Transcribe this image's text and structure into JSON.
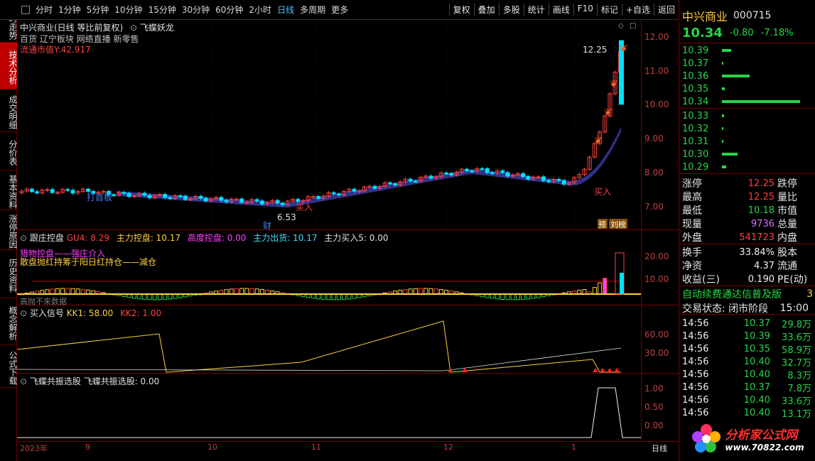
{
  "toolbar": {
    "periods": [
      "分时",
      "1分钟",
      "5分钟",
      "10分钟",
      "15分钟",
      "30分钟",
      "60分钟",
      "2小时",
      "日线",
      "多周期",
      "更多"
    ],
    "active_period": "日线",
    "tools": [
      "复权",
      "叠加",
      "多股",
      "统计",
      "画线",
      "F10",
      "标记",
      "+自选",
      "返回"
    ]
  },
  "left_tabs": [
    "分时走势",
    "技术分析",
    "成交明细",
    "分价表",
    "基本资料",
    "涨停原因",
    "历史资料",
    "概念解析",
    "公式下载"
  ],
  "active_tab": "技术分析",
  "main_pane": {
    "title": "中兴商业(日线 等比前复权)",
    "formula": "飞蝶妖龙",
    "tags": "百货 辽宁板块 网络直播 新零售",
    "market_cap_label": "流通市值Y:42.917",
    "y_ticks": [
      "12.00",
      "11.00",
      "10.00",
      "9.00",
      "8.00",
      "7.00"
    ],
    "y_values": [
      12,
      11,
      10,
      9,
      8,
      7
    ],
    "y_range": [
      6.3,
      12.5
    ],
    "annotations": {
      "high_value": "12.25",
      "low_value": "6.53",
      "daban": "打首板",
      "buy": "买入",
      "cai": "财",
      "yu": "预",
      "liubang": "刘榜"
    }
  },
  "pane2": {
    "name": "跟庄控盘",
    "fields": [
      {
        "text": "GU4: 8.29",
        "color": "#ff4040"
      },
      {
        "text": "主力控盘: 10.17",
        "color": "#ffd040"
      },
      {
        "text": "高度控盘: 0.00",
        "color": "#ff40ff"
      },
      {
        "text": "主力出货: 10.17",
        "color": "#40e0ff"
      },
      {
        "text": "主力买入5: 0.00",
        "color": "#e0e0e0"
      }
    ],
    "legend": [
      "猎物控盘——强庄介入",
      "散盘抛红持筹于阳日红持仓——减仓"
    ],
    "note": "高抛不来数据",
    "y_ticks": [
      "20.00",
      "10.00"
    ]
  },
  "pane3": {
    "name": "买入信号",
    "fields": [
      {
        "text": "KK1: 58.00",
        "color": "#ffd040"
      },
      {
        "text": "KK2: 1.00",
        "color": "#ff4040"
      }
    ],
    "y_ticks": [
      "60.00",
      "30.00"
    ]
  },
  "pane4": {
    "name": "飞蝶共振选股",
    "fields": [
      {
        "text": "飞蝶共振选股: 0.00",
        "color": "#e0e0e0"
      }
    ],
    "y_ticks": [
      "1.00",
      "0.50",
      "0.00"
    ]
  },
  "x_axis": [
    "2023年",
    "9",
    "10",
    "11",
    "12",
    "1"
  ],
  "x_axis_right": "日线",
  "quote": {
    "name": "中兴商业",
    "code": "000715",
    "price": "10.34",
    "change": "-0.80",
    "change_pct": "-7.18%",
    "sell": [
      {
        "price": "10.39",
        "vol": 0.12
      },
      {
        "price": "10.37",
        "vol": 0.02
      },
      {
        "price": "10.36",
        "vol": 0.35
      },
      {
        "price": "10.35",
        "vol": 0.04
      },
      {
        "price": "10.34",
        "vol": 1.0
      }
    ],
    "buy": [
      {
        "price": "10.33",
        "vol": 0.03
      },
      {
        "price": "10.32",
        "vol": 0.02
      },
      {
        "price": "10.31",
        "vol": 0.02
      },
      {
        "price": "10.30",
        "vol": 0.2
      },
      {
        "price": "10.29",
        "vol": 0.05
      }
    ],
    "stats": [
      {
        "k1": "涨停",
        "v1": "12.25",
        "c1": "red",
        "k2": "跌停",
        "v2": "",
        "c2": "green"
      },
      {
        "k1": "最高",
        "v1": "12.25",
        "c1": "red",
        "k2": "量比",
        "v2": "",
        "c2": "white"
      },
      {
        "k1": "最低",
        "v1": "10.18",
        "c1": "green",
        "k2": "市值",
        "v2": "",
        "c2": "white"
      },
      {
        "k1": "现量",
        "v1": "9736",
        "c1": "purple",
        "k2": "总量",
        "v2": "",
        "c2": "white"
      },
      {
        "k1": "外盘",
        "v1": "541723",
        "c1": "red",
        "k2": "内盘",
        "v2": "",
        "c2": "green"
      }
    ],
    "stats2": [
      {
        "k": "换手",
        "v": "33.84%",
        "k2": "股本"
      },
      {
        "k": "净资",
        "v": "4.37",
        "k2": "流通"
      },
      {
        "k": "收益(三)",
        "v": "0.190",
        "k2": "PE(动)"
      }
    ],
    "scroll_notice": "自动续费通达信普及版",
    "scroll_count": "3",
    "trade_status_label": "交易状态: 闭市阶段",
    "trade_time": "15:00",
    "ticks": [
      {
        "t": "14:56",
        "p": "10.37",
        "v": "29.8万"
      },
      {
        "t": "14:56",
        "p": "10.39",
        "v": "33.6万"
      },
      {
        "t": "14:56",
        "p": "10.35",
        "v": "58.9万"
      },
      {
        "t": "14:56",
        "p": "10.40",
        "v": "32.7万"
      },
      {
        "t": "14:56",
        "p": "10.40",
        "v": "8.3万"
      },
      {
        "t": "14:56",
        "p": "10.37",
        "v": "7.8万"
      },
      {
        "t": "14:56",
        "p": "10.40",
        "v": "33.6万"
      },
      {
        "t": "14:56",
        "p": "10.40",
        "v": "13.1万"
      }
    ]
  },
  "logo": {
    "text": "分析家公式网",
    "url": "www.70822.com"
  },
  "colors": {
    "up": "#ff4040",
    "down": "#26d64a",
    "cyan": "#00e0ff",
    "band_blue": "#3a3aa0",
    "band_green": "#1a8a1a"
  }
}
